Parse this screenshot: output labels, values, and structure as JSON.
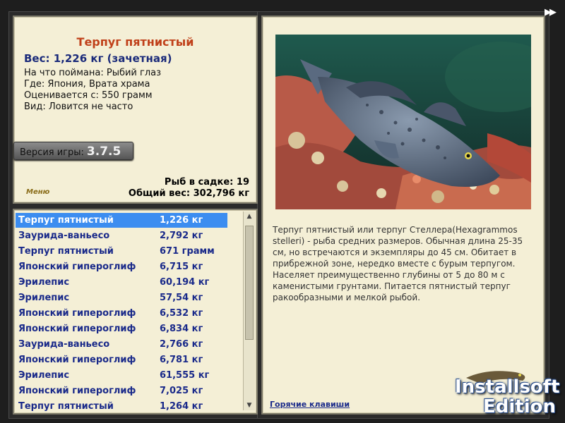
{
  "catch": {
    "title": "Терпуг пятнистый",
    "weight": "Вес: 1,226 кг (зачетная)",
    "details": [
      "На что поймана: Рыбий глаз",
      "Где: Япония, Врата храма",
      "Оценивается с: 550 грамм",
      "Вид: Ловится не часто"
    ],
    "version_label": "Версия игры:",
    "version_number": "3.7.5",
    "fish_in_net": "Рыб в садке: 19",
    "total_weight": "Общий вес: 302,796 кг",
    "menu_label": "Меню"
  },
  "fish_list": [
    {
      "name": "Терпуг пятнистый",
      "weight": "1,226 кг",
      "selected": true
    },
    {
      "name": "Заурида-ваньесо",
      "weight": "2,792 кг"
    },
    {
      "name": "Терпуг пятнистый",
      "weight": "671 грамм"
    },
    {
      "name": "Японский гипероглиф",
      "weight": "6,715 кг"
    },
    {
      "name": "Эрилепис",
      "weight": "60,194 кг"
    },
    {
      "name": "Эрилепис",
      "weight": "57,54 кг"
    },
    {
      "name": "Японский гипероглиф",
      "weight": "6,532 кг"
    },
    {
      "name": "Японский гипероглиф",
      "weight": "6,834 кг"
    },
    {
      "name": "Заурида-ваньесо",
      "weight": "2,766 кг"
    },
    {
      "name": "Японский гипероглиф",
      "weight": "6,781 кг"
    },
    {
      "name": "Эрилепис",
      "weight": "61,555 кг"
    },
    {
      "name": "Японский гипероглиф",
      "weight": "7,025 кг"
    },
    {
      "name": "Терпуг пятнистый",
      "weight": "1,264 кг"
    }
  ],
  "description": "Терпуг пятнистый или терпуг Стеллера(Hexagrammos stelleri) - рыба средних размеров. Обычная длина 25-35 см, но встречаются и экземпляры до 45 см. Обитает в прибрежной зоне, нередко вместе с бурым терпугом. Населяет преимущественно глубины от 5 до 80 м с каменистыми грунтами. Питается пятнистый терпуг ракообразными и мелкой рыбой.",
  "hotkeys_label": "Горячие клавиши",
  "brand": {
    "line1": "Installsoft",
    "line2": "Edition"
  },
  "icons": {
    "forward": "double-arrow-right-icon",
    "scroll_up": "chevron-up-icon",
    "scroll_down": "chevron-down-icon"
  },
  "colors": {
    "selected_row": "#3c8df0",
    "title": "#c0401a",
    "list_text": "#1a2a8a",
    "panel_bg": "#f4efd6"
  }
}
